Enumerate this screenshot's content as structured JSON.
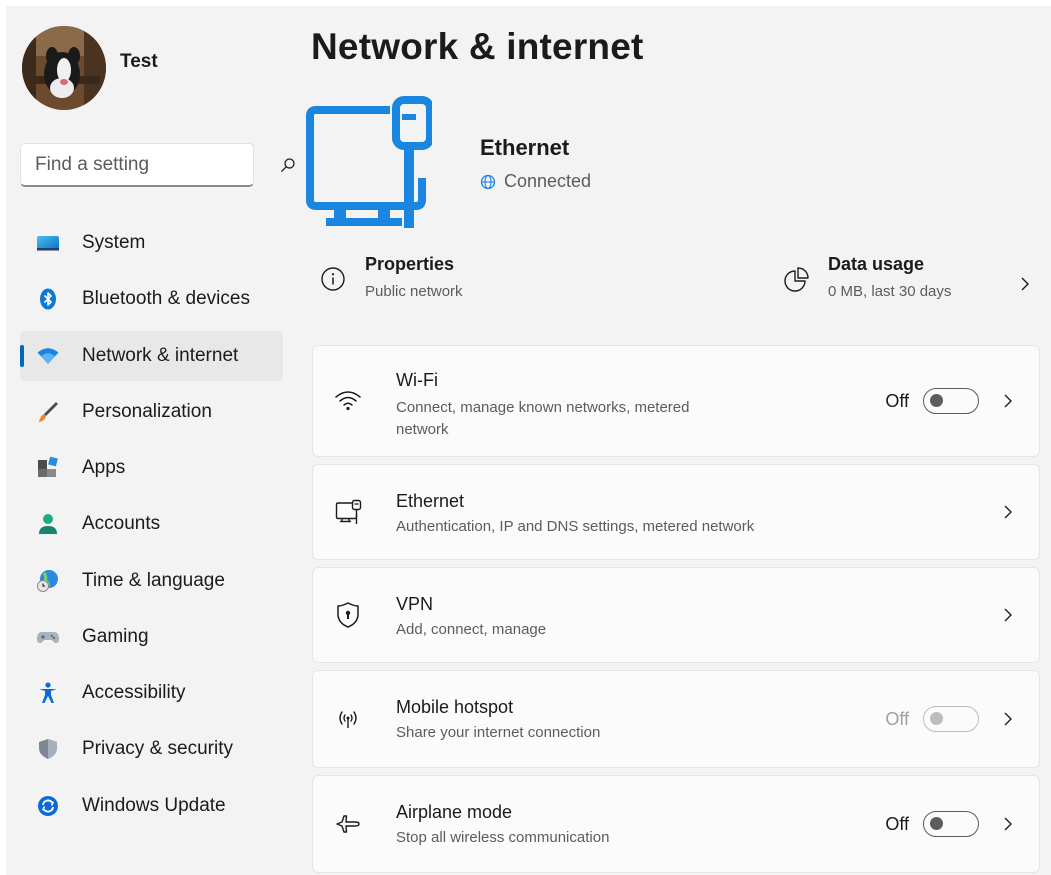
{
  "profile": {
    "name": "Test"
  },
  "search": {
    "placeholder": "Find a setting"
  },
  "sidebar": {
    "items": [
      {
        "label": "System",
        "icon": "monitor-icon"
      },
      {
        "label": "Bluetooth & devices",
        "icon": "bluetooth-icon"
      },
      {
        "label": "Network & internet",
        "icon": "wifi-icon",
        "selected": true
      },
      {
        "label": "Personalization",
        "icon": "brush-icon"
      },
      {
        "label": "Apps",
        "icon": "apps-icon"
      },
      {
        "label": "Accounts",
        "icon": "person-icon"
      },
      {
        "label": "Time & language",
        "icon": "globe-clock-icon"
      },
      {
        "label": "Gaming",
        "icon": "gamepad-icon"
      },
      {
        "label": "Accessibility",
        "icon": "accessibility-icon"
      },
      {
        "label": "Privacy & security",
        "icon": "shield-icon"
      },
      {
        "label": "Windows Update",
        "icon": "update-icon"
      }
    ]
  },
  "page": {
    "title": "Network & internet"
  },
  "hero": {
    "title": "Ethernet",
    "status": "Connected"
  },
  "summary": {
    "properties": {
      "title": "Properties",
      "subtitle": "Public network"
    },
    "data_usage": {
      "title": "Data usage",
      "subtitle": "0 MB, last 30 days"
    }
  },
  "cards": {
    "wifi": {
      "title": "Wi-Fi",
      "subtitle_line1": "Connect, manage known networks, metered",
      "subtitle_line2": "network",
      "toggle_label": "Off",
      "toggle_on": false
    },
    "ethernet": {
      "title": "Ethernet",
      "subtitle": "Authentication, IP and DNS settings, metered network"
    },
    "vpn": {
      "title": "VPN",
      "subtitle": "Add, connect, manage"
    },
    "hotspot": {
      "title": "Mobile hotspot",
      "subtitle": "Share your internet connection",
      "toggle_label": "Off",
      "toggle_on": false,
      "toggle_disabled": true
    },
    "airplane": {
      "title": "Airplane mode",
      "subtitle": "Stop all wireless communication",
      "toggle_label": "Off",
      "toggle_on": false
    }
  },
  "colors": {
    "accent": "#0067c0",
    "window_bg": "#f3f3f3",
    "card_bg": "#fbfbfb"
  }
}
